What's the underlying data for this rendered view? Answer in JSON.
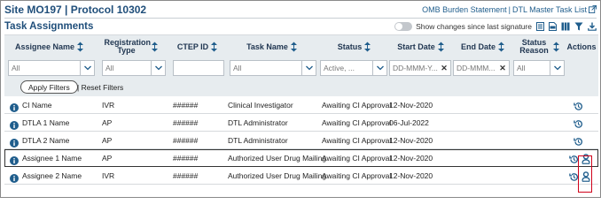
{
  "header": {
    "site_title": "Site MO197 | Protocol 10302",
    "links": [
      "OMB Burden Statement",
      "DTL Master Task List"
    ],
    "link_separator": "|"
  },
  "section": {
    "title": "Task Assignments",
    "toggle_label": "Show changes since last signature",
    "toggle_on": false,
    "tools": [
      "rows-icon",
      "pdf-icon",
      "columns-icon",
      "filter-icon",
      "download-icon"
    ]
  },
  "table": {
    "columns": [
      {
        "key": "assignee",
        "label": "Assignee Name",
        "sortable": true
      },
      {
        "key": "regtype",
        "label": "Registration Type",
        "sortable": true
      },
      {
        "key": "ctep",
        "label": "CTEP ID",
        "sortable": true
      },
      {
        "key": "task",
        "label": "Task Name",
        "sortable": true
      },
      {
        "key": "status",
        "label": "Status",
        "sortable": true
      },
      {
        "key": "start",
        "label": "Start Date",
        "sortable": true
      },
      {
        "key": "end",
        "label": "End Date",
        "sortable": true
      },
      {
        "key": "reason",
        "label": "Status Reason",
        "sortable": true
      },
      {
        "key": "actions",
        "label": "Actions",
        "sortable": false
      }
    ],
    "filters": {
      "assignee": "All",
      "regtype": "All",
      "ctep": "",
      "task": "All",
      "status": "Active, ...",
      "start_placeholder": "DD-MMM-Y...",
      "end_placeholder": "DD-MMM...",
      "reason": "All"
    },
    "apply_label": "Apply Filters",
    "reset_label": "| Reset Filters",
    "rows": [
      {
        "assignee": "CI Name",
        "regtype": "IVR",
        "ctep": "######",
        "task": "Clinical Investigator",
        "status": "Awaiting CI Approval",
        "start": "12-Nov-2020",
        "end": "",
        "reason": "",
        "actions": [
          "history-icon"
        ],
        "highlight": false
      },
      {
        "assignee": "DTLA 1 Name",
        "regtype": "AP",
        "ctep": "######",
        "task": "DTL Administrator",
        "status": "Awaiting CI Approval",
        "start": "06-Jul-2022",
        "end": "",
        "reason": "",
        "actions": [
          "history-icon"
        ],
        "highlight": false
      },
      {
        "assignee": "DTLA 2 Name",
        "regtype": "AP",
        "ctep": "######",
        "task": "DTL Administrator",
        "status": "Awaiting CI Approval",
        "start": "12-Nov-2020",
        "end": "",
        "reason": "",
        "actions": [
          "history-icon"
        ],
        "highlight": false
      },
      {
        "assignee": "Assignee 1 Name",
        "regtype": "AP",
        "ctep": "######",
        "task": "Authorized User Drug Mailing",
        "status": "Awaiting CI Approval",
        "start": "12-Nov-2020",
        "end": "",
        "reason": "",
        "actions": [
          "history-icon",
          "user-assign-icon"
        ],
        "highlight": true
      },
      {
        "assignee": "Assignee 2 Name",
        "regtype": "IVR",
        "ctep": "######",
        "task": "Authorized User Drug Mailing",
        "status": "Awaiting CI Approval",
        "start": "12-Nov-2020",
        "end": "",
        "reason": "",
        "actions": [
          "history-icon",
          "user-assign-icon"
        ],
        "highlight": false
      }
    ]
  },
  "colors": {
    "title": "#1f4e7a",
    "link": "#1f5d8c",
    "icon": "#1f5d8c",
    "header_bg": "#e7ecef",
    "highlight_box": "#d0021b"
  }
}
